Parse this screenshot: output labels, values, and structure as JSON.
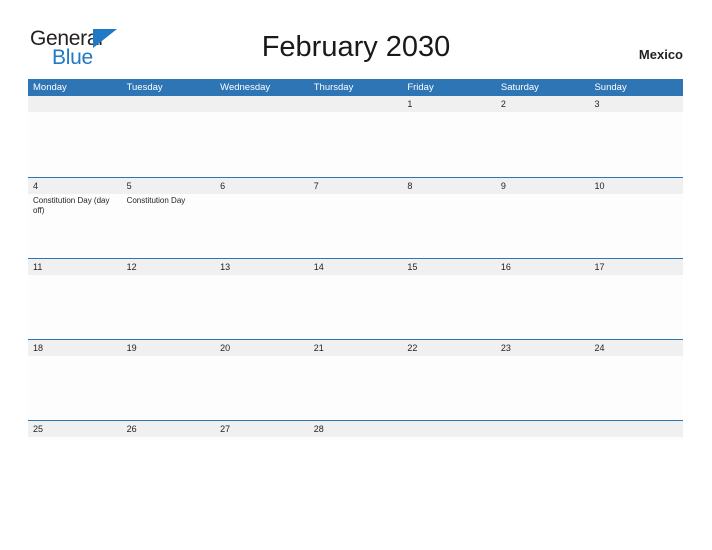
{
  "brand": {
    "word_one": "General",
    "word_two": "Blue",
    "flag_icon": "blue-triangle-flag",
    "accent_color": "#2079c4"
  },
  "header": {
    "title": "February 2030",
    "country": "Mexico"
  },
  "colors": {
    "header_blue": "#2e75b6",
    "date_band_gray": "#f0f0f0",
    "cell_white": "#fdfdfd",
    "text_dark": "#231f20"
  },
  "calendar": {
    "day_names": [
      "Monday",
      "Tuesday",
      "Wednesday",
      "Thursday",
      "Friday",
      "Saturday",
      "Sunday"
    ],
    "weeks": [
      [
        {
          "num": "",
          "events": []
        },
        {
          "num": "",
          "events": []
        },
        {
          "num": "",
          "events": []
        },
        {
          "num": "",
          "events": []
        },
        {
          "num": "1",
          "events": []
        },
        {
          "num": "2",
          "events": []
        },
        {
          "num": "3",
          "events": []
        }
      ],
      [
        {
          "num": "4",
          "events": [
            "Constitution Day (day off)"
          ]
        },
        {
          "num": "5",
          "events": [
            "Constitution Day"
          ]
        },
        {
          "num": "6",
          "events": []
        },
        {
          "num": "7",
          "events": []
        },
        {
          "num": "8",
          "events": []
        },
        {
          "num": "9",
          "events": []
        },
        {
          "num": "10",
          "events": []
        }
      ],
      [
        {
          "num": "11",
          "events": []
        },
        {
          "num": "12",
          "events": []
        },
        {
          "num": "13",
          "events": []
        },
        {
          "num": "14",
          "events": []
        },
        {
          "num": "15",
          "events": []
        },
        {
          "num": "16",
          "events": []
        },
        {
          "num": "17",
          "events": []
        }
      ],
      [
        {
          "num": "18",
          "events": []
        },
        {
          "num": "19",
          "events": []
        },
        {
          "num": "20",
          "events": []
        },
        {
          "num": "21",
          "events": []
        },
        {
          "num": "22",
          "events": []
        },
        {
          "num": "23",
          "events": []
        },
        {
          "num": "24",
          "events": []
        }
      ],
      [
        {
          "num": "25",
          "events": []
        },
        {
          "num": "26",
          "events": []
        },
        {
          "num": "27",
          "events": []
        },
        {
          "num": "28",
          "events": []
        },
        {
          "num": "",
          "events": []
        },
        {
          "num": "",
          "events": []
        },
        {
          "num": "",
          "events": []
        }
      ]
    ]
  }
}
